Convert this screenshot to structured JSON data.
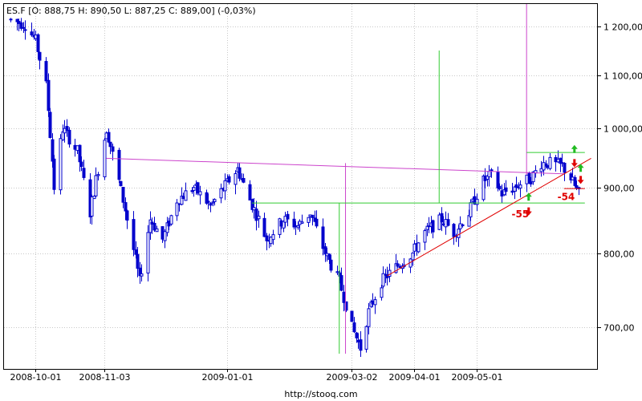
{
  "header": {
    "text": "ES.F [O: 888,75  H: 890,50  L: 887,25  C: 889,00] (-0,03%)"
  },
  "source_label": "http://stooq.com",
  "colors": {
    "candle": "#0000cc",
    "trend_magenta": "#cc44cc",
    "trend_green": "#33cc33",
    "trend_red": "#e00000",
    "grid": "#c8c8c8",
    "frame": "#000000"
  },
  "chart_data": {
    "type": "candlestick",
    "title": "ES.F",
    "ohlc_latest": {
      "open": "888,75",
      "high": "890,50",
      "low": "887,25",
      "close": "889,00",
      "change": "-0,03%"
    },
    "ylim": [
      650,
      1250
    ],
    "y_scale": "log",
    "y_ticks": [
      {
        "value": 700,
        "label": "700,00"
      },
      {
        "value": 800,
        "label": "800,00"
      },
      {
        "value": 900,
        "label": "900,00"
      },
      {
        "value": 1000,
        "label": "1 000,00"
      },
      {
        "value": 1100,
        "label": "1 100,00"
      },
      {
        "value": 1200,
        "label": "1 200,00"
      }
    ],
    "x_range": [
      "2008-09-19",
      "2009-06-19"
    ],
    "x_ticks": [
      {
        "date": "2008-10-01",
        "label": "2008-10-01"
      },
      {
        "date": "2008-11-03",
        "label": "2008-11-03"
      },
      {
        "date": "2009-01-01",
        "label": "2009-01-01"
      },
      {
        "date": "2009-03-02",
        "label": "2009-03-02"
      },
      {
        "date": "2009-04-01",
        "label": "2009-04-01"
      },
      {
        "date": "2009-05-01",
        "label": "2009-05-01"
      }
    ],
    "close_path": [
      [
        "2008-09-19",
        1215
      ],
      [
        "2008-09-26",
        1205
      ],
      [
        "2008-10-01",
        1170
      ],
      [
        "2008-10-06",
        1080
      ],
      [
        "2008-10-10",
        900
      ],
      [
        "2008-10-14",
        1000
      ],
      [
        "2008-10-21",
        960
      ],
      [
        "2008-10-27",
        860
      ],
      [
        "2008-11-04",
        1000
      ],
      [
        "2008-11-12",
        880
      ],
      [
        "2008-11-20",
        760
      ],
      [
        "2008-11-25",
        850
      ],
      [
        "2008-12-01",
        820
      ],
      [
        "2008-12-08",
        880
      ],
      [
        "2008-12-16",
        900
      ],
      [
        "2008-12-24",
        870
      ],
      [
        "2009-01-06",
        930
      ],
      [
        "2009-01-12",
        880
      ],
      [
        "2009-01-20",
        820
      ],
      [
        "2009-01-28",
        850
      ],
      [
        "2009-02-04",
        840
      ],
      [
        "2009-02-10",
        860
      ],
      [
        "2009-02-17",
        800
      ],
      [
        "2009-02-24",
        760
      ],
      [
        "2009-03-02",
        700
      ],
      [
        "2009-03-06",
        675
      ],
      [
        "2009-03-10",
        720
      ],
      [
        "2009-03-16",
        760
      ],
      [
        "2009-03-23",
        780
      ],
      [
        "2009-03-31",
        800
      ],
      [
        "2009-04-06",
        830
      ],
      [
        "2009-04-14",
        850
      ],
      [
        "2009-04-20",
        830
      ],
      [
        "2009-04-27",
        860
      ],
      [
        "2009-05-04",
        910
      ],
      [
        "2009-05-08",
        920
      ],
      [
        "2009-05-13",
        890
      ],
      [
        "2009-05-19",
        900
      ],
      [
        "2009-05-27",
        915
      ],
      [
        "2009-06-01",
        940
      ],
      [
        "2009-06-05",
        940
      ],
      [
        "2009-06-11",
        935
      ],
      [
        "2009-06-15",
        915
      ],
      [
        "2009-06-19",
        889
      ]
    ],
    "trend_lines": [
      {
        "color": "magenta",
        "points": [
          [
            "2008-11-04",
            948
          ],
          [
            "2009-06-12",
            922
          ]
        ]
      },
      {
        "color": "magenta",
        "points": [
          [
            "2009-02-27",
            940
          ],
          [
            "2009-02-27",
            668
          ]
        ]
      },
      {
        "color": "magenta",
        "points": [
          [
            "2009-05-25",
            1250
          ],
          [
            "2009-05-25",
            920
          ]
        ]
      },
      {
        "color": "green",
        "points": [
          [
            "2009-01-13",
            875
          ],
          [
            "2009-06-22",
            875
          ]
        ]
      },
      {
        "color": "green",
        "points": [
          [
            "2009-02-24",
            875
          ],
          [
            "2009-02-24",
            668
          ]
        ]
      },
      {
        "color": "green",
        "points": [
          [
            "2009-04-13",
            1150
          ],
          [
            "2009-04-13",
            875
          ]
        ]
      },
      {
        "color": "green",
        "points": [
          [
            "2009-05-25",
            958
          ],
          [
            "2009-06-22",
            958
          ]
        ]
      },
      {
        "color": "red",
        "points": [
          [
            "2009-03-19",
            768
          ],
          [
            "2009-06-25",
            948
          ]
        ]
      },
      {
        "color": "red",
        "points": [
          [
            "2009-06-12",
            898
          ],
          [
            "2009-06-22",
            898
          ]
        ]
      }
    ],
    "annotations": [
      {
        "label": "-55",
        "date": "2009-05-22",
        "value": 858
      },
      {
        "label": "-54",
        "date": "2009-06-13",
        "value": 885
      }
    ],
    "arrows": [
      {
        "direction": "up",
        "color": "green",
        "date": "2009-05-26",
        "value": 885
      },
      {
        "direction": "down",
        "color": "red",
        "date": "2009-05-26",
        "value": 862
      },
      {
        "direction": "up",
        "color": "green",
        "date": "2009-06-17",
        "value": 964
      },
      {
        "direction": "down",
        "color": "red",
        "date": "2009-06-17",
        "value": 940
      },
      {
        "direction": "up",
        "color": "green",
        "date": "2009-06-20",
        "value": 932
      },
      {
        "direction": "down",
        "color": "red",
        "date": "2009-06-20",
        "value": 912
      }
    ]
  }
}
